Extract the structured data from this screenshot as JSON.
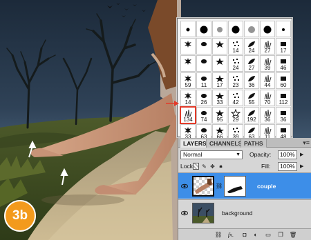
{
  "step_badge": "3b",
  "brushes": {
    "rows": [
      [
        "",
        "",
        "",
        "",
        "",
        "",
        ""
      ],
      [
        "",
        "",
        "",
        "14",
        "24",
        "27",
        "17"
      ],
      [
        "",
        "",
        "",
        "24",
        "27",
        "39",
        "46"
      ],
      [
        "59",
        "11",
        "17",
        "23",
        "36",
        "44",
        "60"
      ],
      [
        "14",
        "26",
        "33",
        "42",
        "55",
        "70",
        "112"
      ],
      [
        "134",
        "74",
        "95",
        "29",
        "192",
        "36",
        "36"
      ],
      [
        "33",
        "63",
        "66",
        "39",
        "63",
        "11",
        "48"
      ]
    ],
    "selected_size": "134"
  },
  "layers_panel": {
    "tabs": [
      "LAYERS",
      "CHANNELS",
      "PATHS"
    ],
    "active_tab": "LAYERS",
    "blend_mode": "Normal",
    "opacity_label": "Opacity:",
    "opacity_value": "100%",
    "lock_label": "Lock:",
    "fill_label": "Fill:",
    "fill_value": "100%",
    "layers": [
      {
        "name": "couple",
        "selected": true,
        "has_mask": true
      },
      {
        "name": "background",
        "selected": false,
        "has_mask": false
      }
    ]
  },
  "colors": {
    "selection_blue": "#3d8ee8",
    "badge_orange": "#f39a1c",
    "highlight_red": "#e23b2a"
  }
}
